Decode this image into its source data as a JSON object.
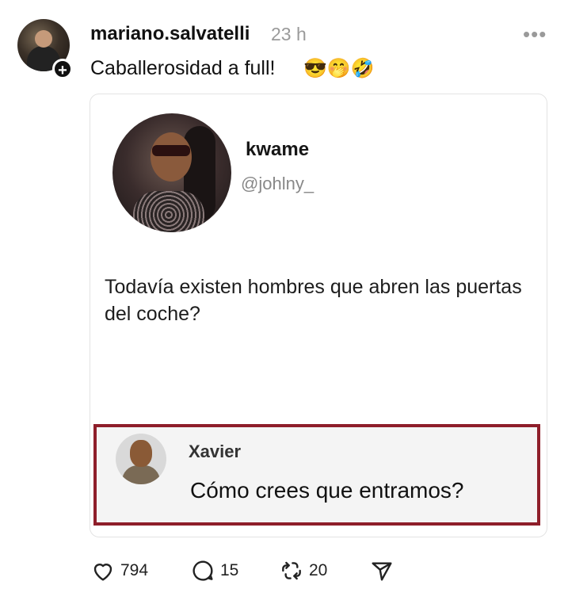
{
  "post": {
    "username": "mariano.salvatelli",
    "time": "23 h",
    "more": "•••",
    "caption": "Caballerosidad a full!",
    "emojis": "😎🤭🤣",
    "follow_badge": "+"
  },
  "embedded": {
    "name": "kwame",
    "handle": "@johlny_",
    "text": "Todavía existen hombres que abren las puertas del coche?",
    "reply": {
      "name": "Xavier",
      "text": "Cómo crees que entramos?"
    }
  },
  "actions": {
    "likes": "794",
    "comments": "15",
    "reposts": "20"
  },
  "colors": {
    "reply_border": "#8e1e2a",
    "muted": "#9a9a9a"
  }
}
